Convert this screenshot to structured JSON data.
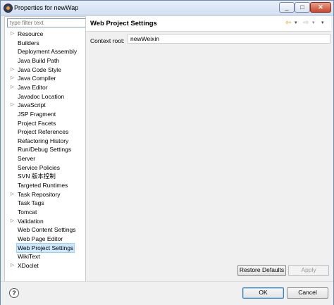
{
  "window": {
    "title": "Properties for newWap",
    "minimize": "_",
    "maximize": "□",
    "close": "✕"
  },
  "filter": {
    "placeholder": "type filter text",
    "value": ""
  },
  "tree": [
    {
      "label": "Resource",
      "expandable": true
    },
    {
      "label": "Builders",
      "expandable": false
    },
    {
      "label": "Deployment Assembly",
      "expandable": false
    },
    {
      "label": "Java Build Path",
      "expandable": false
    },
    {
      "label": "Java Code Style",
      "expandable": true
    },
    {
      "label": "Java Compiler",
      "expandable": true
    },
    {
      "label": "Java Editor",
      "expandable": true
    },
    {
      "label": "Javadoc Location",
      "expandable": false
    },
    {
      "label": "JavaScript",
      "expandable": true
    },
    {
      "label": "JSP Fragment",
      "expandable": false
    },
    {
      "label": "Project Facets",
      "expandable": false
    },
    {
      "label": "Project References",
      "expandable": false
    },
    {
      "label": "Refactoring History",
      "expandable": false
    },
    {
      "label": "Run/Debug Settings",
      "expandable": false
    },
    {
      "label": "Server",
      "expandable": false
    },
    {
      "label": "Service Policies",
      "expandable": false
    },
    {
      "label": "SVN 版本控制",
      "expandable": false
    },
    {
      "label": "Targeted Runtimes",
      "expandable": false
    },
    {
      "label": "Task Repository",
      "expandable": true
    },
    {
      "label": "Task Tags",
      "expandable": false
    },
    {
      "label": "Tomcat",
      "expandable": false
    },
    {
      "label": "Validation",
      "expandable": true
    },
    {
      "label": "Web Content Settings",
      "expandable": false
    },
    {
      "label": "Web Page Editor",
      "expandable": false
    },
    {
      "label": "Web Project Settings",
      "expandable": false,
      "selected": true
    },
    {
      "label": "WikiText",
      "expandable": false
    },
    {
      "label": "XDoclet",
      "expandable": true
    }
  ],
  "page": {
    "title": "Web Project Settings",
    "context_root_label": "Context root:",
    "context_root_value": "newWeixin",
    "nav": {
      "back": "⇦",
      "back_dropdown": "▾",
      "forward": "⇨",
      "forward_dropdown": "▾",
      "menu": "▾"
    }
  },
  "buttons": {
    "restore_defaults": "Restore Defaults",
    "apply": "Apply",
    "ok": "OK",
    "cancel": "Cancel",
    "help": "?"
  }
}
